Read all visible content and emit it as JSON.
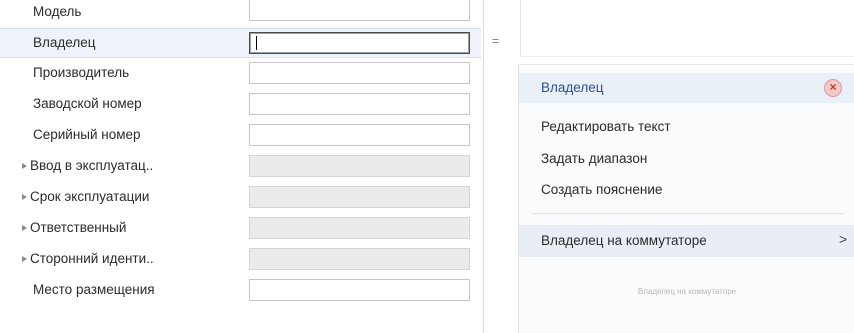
{
  "form": {
    "rows": [
      {
        "label": "Модель"
      },
      {
        "label": "Владелец"
      },
      {
        "label": "Производитель"
      },
      {
        "label": "Заводской номер"
      },
      {
        "label": "Серийный номер"
      },
      {
        "label": "Ввод в эксплуатац.."
      },
      {
        "label": "Срок эксплуатации"
      },
      {
        "label": "Ответственный"
      },
      {
        "label": "Сторонний иденти.."
      },
      {
        "label": "Место размещения"
      }
    ]
  },
  "right_panel": {
    "operator": "="
  },
  "context_menu": {
    "title": "Владелец",
    "items": [
      {
        "label": "Редактировать текст"
      },
      {
        "label": "Задать диапазон"
      },
      {
        "label": "Создать пояснение"
      }
    ],
    "submenu": {
      "label": "Владелец на коммутаторе",
      "arrow": ">"
    },
    "hint": "Владелец на коммутаторе"
  },
  "colors": {
    "selected_row": "#eef3fa",
    "menu_title_text": "#2c4f8e",
    "disabled_field": "#ebebeb"
  },
  "icons": {
    "close": "close-circle-icon",
    "group_toggle": "triangle-right-icon",
    "submenu_arrow": "chevron-right-icon"
  }
}
